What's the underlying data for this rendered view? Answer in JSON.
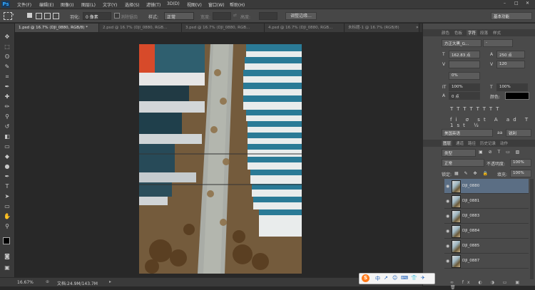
{
  "app": {
    "logo": "Ps"
  },
  "menu": [
    "文件(F)",
    "编辑(E)",
    "图像(I)",
    "图层(L)",
    "文字(Y)",
    "选择(S)",
    "滤镜(T)",
    "3D(D)",
    "视图(V)",
    "窗口(W)",
    "帮助(H)"
  ],
  "window_controls": {
    "minimize": "–",
    "maximize": "□",
    "close": "✕"
  },
  "options": {
    "feather_label": "羽化:",
    "feather_value": "0 像素",
    "antialias_label": "消除锯齿",
    "style_label": "样式:",
    "style_value": "正常",
    "width_label": "宽度:",
    "height_label": "高度:",
    "refine_edge": "调整边缘...",
    "workspace": "基本功能"
  },
  "tabs": [
    {
      "label": "1.psd @ 16.7% (DJI_0880, RGB/8) *",
      "active": true
    },
    {
      "label": "2.psd @ 16.7% (DJI_0880, RGB..."
    },
    {
      "label": "3.psd @ 16.7% (DJI_0880, RGB..."
    },
    {
      "label": "4.psd @ 16.7% (DJI_0880, RGB..."
    },
    {
      "label": "未标题-1 @ 16.7% (RGB/8)"
    }
  ],
  "status": {
    "zoom": "16.67%",
    "doc": "文档:24.9M/143.7M"
  },
  "char_panel": {
    "tabs": [
      "颜色",
      "色板",
      "字符",
      "段落",
      "样式"
    ],
    "active_tab": "字符",
    "font_family": "方正大黑_G...",
    "font_style": "-",
    "font_size": "162.83 点",
    "leading": "250 点",
    "kerning": "",
    "tracking": "120",
    "baseline_scale": "0%",
    "vscale": "100%",
    "hscale": "100%",
    "baseline_shift": "0 点",
    "color_label": "颜色:",
    "language": "美国英语",
    "aa_label": "aa",
    "aa_value": "锐利"
  },
  "layers_panel": {
    "tabs": [
      "图层",
      "通道",
      "路径",
      "历史记录",
      "动作"
    ],
    "active_tab": "图层",
    "filter": "类型",
    "blend_mode": "正常",
    "opacity_label": "不透明度:",
    "opacity": "100%",
    "lock_label": "锁定:",
    "fill_label": "填充:",
    "fill": "100%",
    "layers": [
      "DJI_0880",
      "DJI_0881",
      "DJI_0883",
      "DJI_0884",
      "DJI_0885",
      "DJI_0887"
    ]
  },
  "ime": {
    "brand": "S",
    "items": [
      "中",
      "↗",
      "☺",
      "⌨",
      "👕",
      "✈"
    ]
  }
}
